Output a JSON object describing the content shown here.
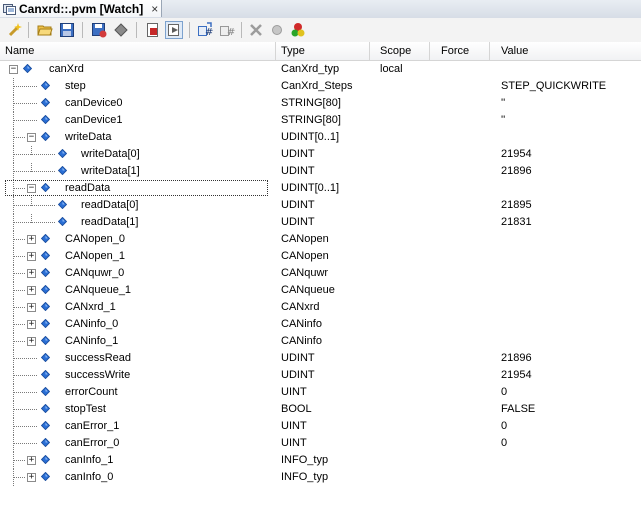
{
  "tab": {
    "title": "Canxrd::.pvm [Watch]",
    "close": "×"
  },
  "toolbar": {
    "buttons": [
      {
        "icon": "add-variable-icon"
      },
      {
        "icon": "open-folder-icon"
      },
      {
        "icon": "save-icon"
      },
      {
        "icon": "save-as-icon"
      },
      {
        "icon": "import-icon"
      },
      {
        "icon": "record-icon"
      },
      {
        "icon": "play-icon"
      },
      {
        "icon": "force-icon"
      },
      {
        "icon": "unforce-icon"
      },
      {
        "icon": "disconnect-icon"
      },
      {
        "icon": "gray-dot-icon"
      },
      {
        "icon": "traffic-light-icon"
      }
    ]
  },
  "columns": {
    "name": "Name",
    "type": "Type",
    "scope": "Scope",
    "force": "Force",
    "value": "Value"
  },
  "rows": [
    {
      "name": "canXrd",
      "type": "CanXrd_typ",
      "scope": "local",
      "value": "",
      "depth": 0,
      "exp": "minus"
    },
    {
      "name": "step",
      "type": "CanXrd_Steps",
      "scope": "",
      "value": "STEP_QUICKWRITE",
      "depth": 1,
      "exp": ""
    },
    {
      "name": "canDevice0",
      "type": "STRING[80]",
      "scope": "",
      "value": "''",
      "depth": 1,
      "exp": ""
    },
    {
      "name": "canDevice1",
      "type": "STRING[80]",
      "scope": "",
      "value": "''",
      "depth": 1,
      "exp": ""
    },
    {
      "name": "writeData",
      "type": "UDINT[0..1]",
      "scope": "",
      "value": "",
      "depth": 1,
      "exp": "minus"
    },
    {
      "name": "writeData[0]",
      "type": "UDINT",
      "scope": "",
      "value": "21954",
      "depth": 2,
      "exp": ""
    },
    {
      "name": "writeData[1]",
      "type": "UDINT",
      "scope": "",
      "value": "21896",
      "depth": 2,
      "exp": ""
    },
    {
      "name": "readData",
      "type": "UDINT[0..1]",
      "scope": "",
      "value": "",
      "depth": 1,
      "exp": "minus"
    },
    {
      "name": "readData[0]",
      "type": "UDINT",
      "scope": "",
      "value": "21895",
      "depth": 2,
      "exp": ""
    },
    {
      "name": "readData[1]",
      "type": "UDINT",
      "scope": "",
      "value": "21831",
      "depth": 2,
      "exp": ""
    },
    {
      "name": "CANopen_0",
      "type": "CANopen",
      "scope": "",
      "value": "",
      "depth": 1,
      "exp": "plus"
    },
    {
      "name": "CANopen_1",
      "type": "CANopen",
      "scope": "",
      "value": "",
      "depth": 1,
      "exp": "plus"
    },
    {
      "name": "CANquwr_0",
      "type": "CANquwr",
      "scope": "",
      "value": "",
      "depth": 1,
      "exp": "plus"
    },
    {
      "name": "CANqueue_1",
      "type": "CANqueue",
      "scope": "",
      "value": "",
      "depth": 1,
      "exp": "plus"
    },
    {
      "name": "CANxrd_1",
      "type": "CANxrd",
      "scope": "",
      "value": "",
      "depth": 1,
      "exp": "plus"
    },
    {
      "name": "CANinfo_0",
      "type": "CANinfo",
      "scope": "",
      "value": "",
      "depth": 1,
      "exp": "plus"
    },
    {
      "name": "CANinfo_1",
      "type": "CANinfo",
      "scope": "",
      "value": "",
      "depth": 1,
      "exp": "plus"
    },
    {
      "name": "successRead",
      "type": "UDINT",
      "scope": "",
      "value": "21896",
      "depth": 1,
      "exp": ""
    },
    {
      "name": "successWrite",
      "type": "UDINT",
      "scope": "",
      "value": "21954",
      "depth": 1,
      "exp": ""
    },
    {
      "name": "errorCount",
      "type": "UINT",
      "scope": "",
      "value": "0",
      "depth": 1,
      "exp": ""
    },
    {
      "name": "stopTest",
      "type": "BOOL",
      "scope": "",
      "value": "FALSE",
      "depth": 1,
      "exp": ""
    },
    {
      "name": "canError_1",
      "type": "UINT",
      "scope": "",
      "value": "0",
      "depth": 1,
      "exp": ""
    },
    {
      "name": "canError_0",
      "type": "UINT",
      "scope": "",
      "value": "0",
      "depth": 1,
      "exp": ""
    },
    {
      "name": "canInfo_1",
      "type": "INFO_typ",
      "scope": "",
      "value": "",
      "depth": 1,
      "exp": "plus"
    },
    {
      "name": "canInfo_0",
      "type": "INFO_typ",
      "scope": "",
      "value": "",
      "depth": 1,
      "exp": "plus"
    }
  ],
  "colors": {
    "diamond": "#2a6fd6",
    "diamond_dark": "#1b4e9e",
    "header_line": "#d5d5d5"
  }
}
